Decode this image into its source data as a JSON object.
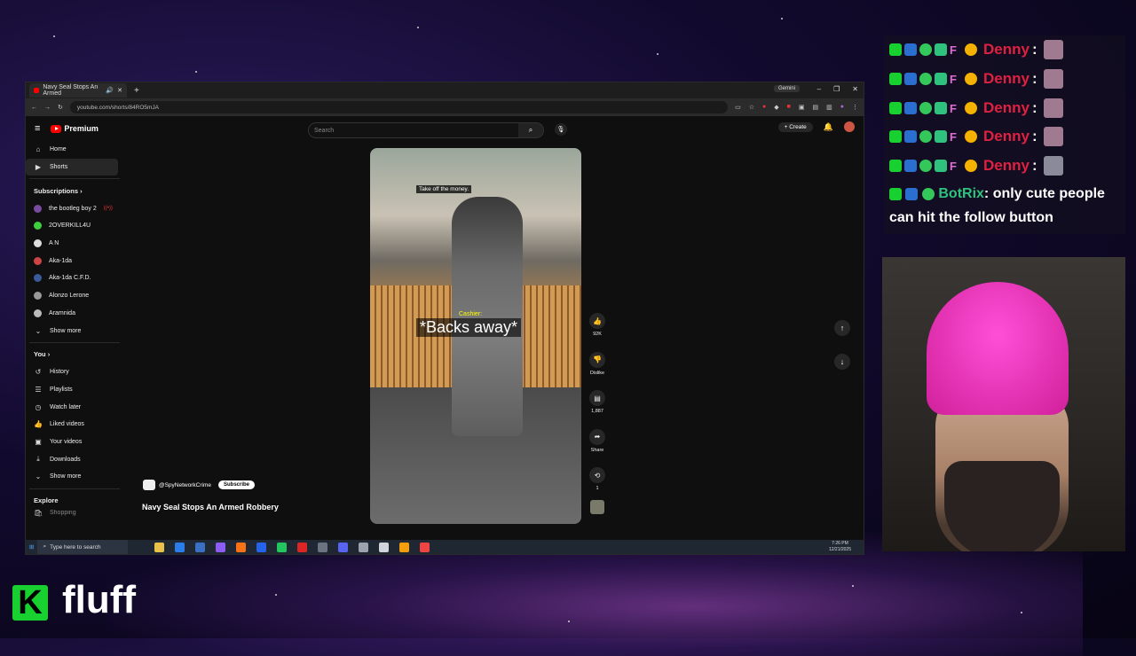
{
  "browser": {
    "tab_title": "Navy Seal Stops An Armed",
    "new_tab": "+",
    "gemini_label": "Gemini",
    "url": "youtube.com/shorts/84RO5mJA"
  },
  "youtube": {
    "logo_text": "Premium",
    "search_placeholder": "Search",
    "create_label": "Create",
    "sidebar": {
      "main": [
        {
          "label": "Home",
          "icon": "home-icon"
        },
        {
          "label": "Shorts",
          "icon": "shorts-icon"
        }
      ],
      "subscriptions_heading": "Subscriptions",
      "subscriptions": [
        {
          "label": "the bootleg boy 2",
          "color": "#7a4aa0"
        },
        {
          "label": "2OVERKILL4U",
          "color": "#3ecf3e"
        },
        {
          "label": "A N",
          "color": "#dddddd"
        },
        {
          "label": "Aka-1da",
          "color": "#c44"
        },
        {
          "label": "Aka-1da C.F.D.",
          "color": "#3a5a9a"
        },
        {
          "label": "Alonzo Lerone",
          "color": "#999"
        },
        {
          "label": "Aramnida",
          "color": "#bbb"
        }
      ],
      "show_more": "Show more",
      "you_heading": "You",
      "you_items": [
        {
          "label": "History",
          "icon": "history-icon"
        },
        {
          "label": "Playlists",
          "icon": "playlists-icon"
        },
        {
          "label": "Watch later",
          "icon": "watch-later-icon"
        },
        {
          "label": "Liked videos",
          "icon": "like-icon"
        },
        {
          "label": "Your videos",
          "icon": "your-videos-icon"
        },
        {
          "label": "Downloads",
          "icon": "download-icon"
        }
      ],
      "show_more_2": "Show more",
      "explore_heading": "Explore",
      "explore_partial": "Shopping"
    },
    "video": {
      "caption_top": "Take off the money.",
      "caption_speaker": "Cashier:",
      "caption_main": "*Backs away*"
    },
    "actions": {
      "likes": "92K",
      "dislike": "Dislike",
      "comments": "1,887",
      "share": "Share",
      "remix": "1"
    },
    "channel": "@SpyNetworkCrime",
    "subscribe": "Subscribe",
    "title": "Navy Seal Stops An Armed Robbery"
  },
  "taskbar": {
    "search_placeholder": "Type here to search",
    "time": "7:26 PM",
    "date": "12/21/2025"
  },
  "chat": {
    "messages": [
      {
        "user": "Denny",
        "sep": ":"
      },
      {
        "user": "Denny",
        "sep": ":"
      },
      {
        "user": "Denny",
        "sep": ":"
      },
      {
        "user": "Denny",
        "sep": ":"
      },
      {
        "user": "Denny",
        "sep": ":"
      }
    ],
    "bot_user": "BotRix",
    "bot_text": ": only cute people can hit the follow button"
  },
  "overlay": {
    "brand_k": "K",
    "brand_text": "fluff"
  },
  "colors": {
    "accent_red": "#ff0000",
    "chat_name_red": "#e02040",
    "bot_green": "#2ec27e",
    "kick_green": "#18d02f"
  }
}
